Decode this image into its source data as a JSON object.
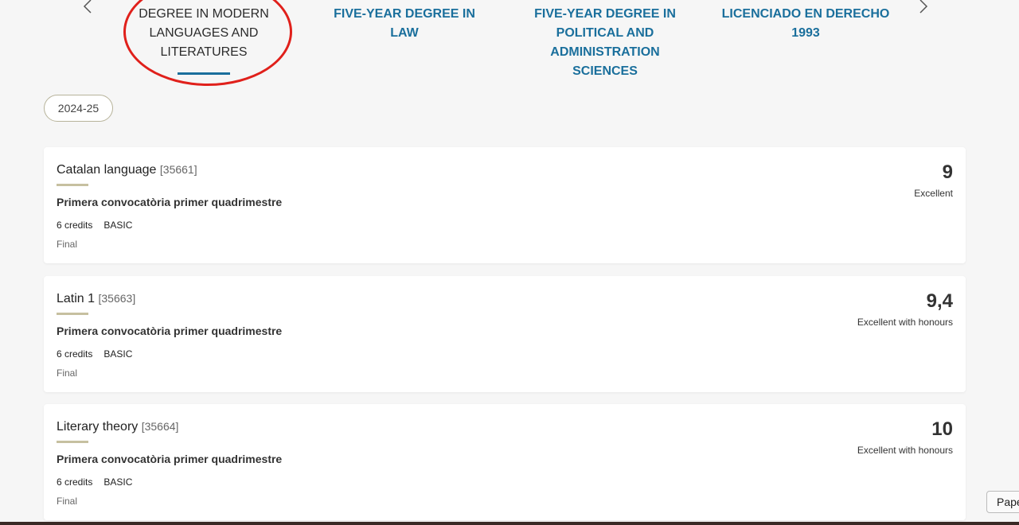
{
  "tabs": [
    {
      "label": "DEGREE IN MODERN LANGUAGES AND LITERATURES",
      "active": true
    },
    {
      "label": "FIVE-YEAR DEGREE IN LAW",
      "active": false
    },
    {
      "label": "FIVE-YEAR DEGREE IN POLITICAL AND ADMINISTRATION SCIENCES",
      "active": false
    },
    {
      "label": "LICENCIADO EN DERECHO 1993",
      "active": false
    }
  ],
  "colors": {
    "accent": "#1a6f9c",
    "annotation": "#e0201b",
    "rule": "#c6c0a0"
  },
  "year": "2024-25",
  "subjects": [
    {
      "name": "Catalan language",
      "code": "[35661]",
      "call": "Primera convocatòria primer quadrimestre",
      "credits": "6 credits",
      "type": "BASIC",
      "status": "Final",
      "grade": "9",
      "grade_label": "Excellent"
    },
    {
      "name": "Latin 1",
      "code": "[35663]",
      "call": "Primera convocatòria primer quadrimestre",
      "credits": "6 credits",
      "type": "BASIC",
      "status": "Final",
      "grade": "9,4",
      "grade_label": "Excellent with honours"
    },
    {
      "name": "Literary theory",
      "code": "[35664]",
      "call": "Primera convocatòria primer quadrimestre",
      "credits": "6 credits",
      "type": "BASIC",
      "status": "Final",
      "grade": "10",
      "grade_label": "Excellent with honours"
    }
  ],
  "paper_button": "Pape"
}
